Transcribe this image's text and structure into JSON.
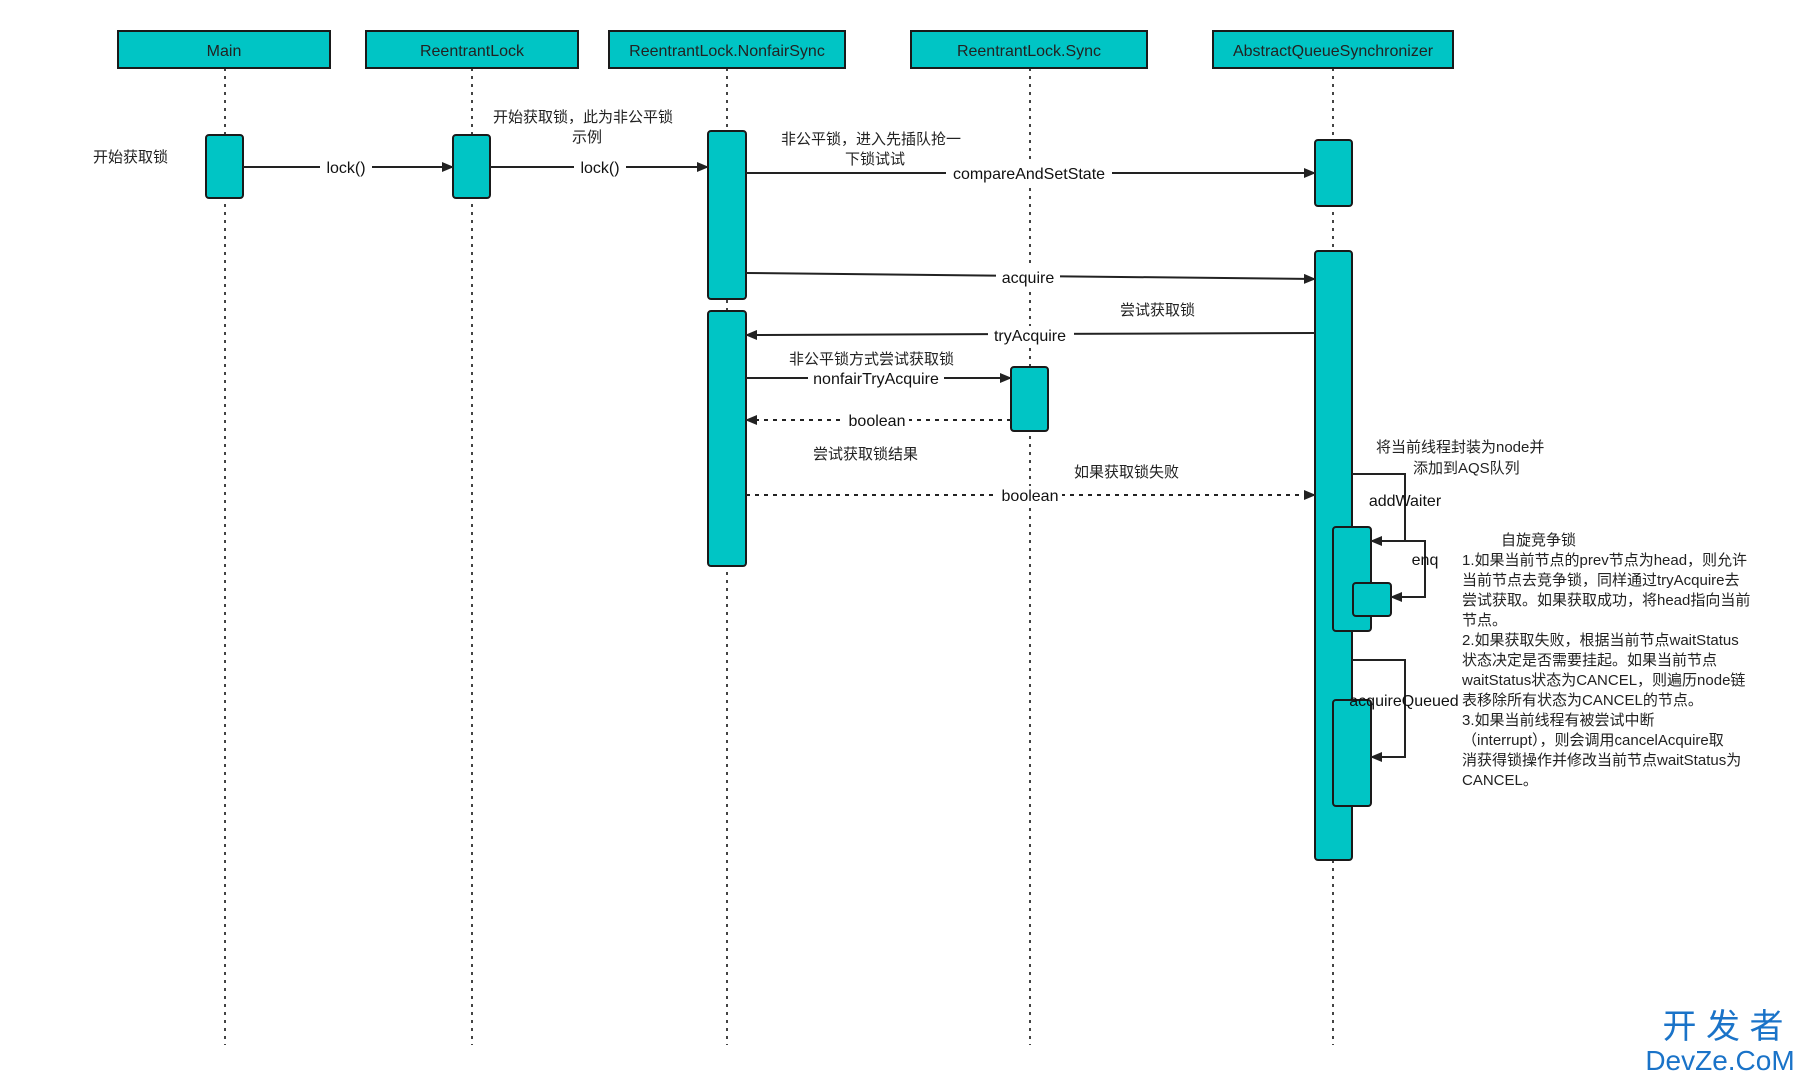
{
  "participants": [
    "Main",
    "ReentrantLock",
    "ReentrantLock.NonfairSync",
    "ReentrantLock.Sync",
    "AbstractQueueSynchronizer"
  ],
  "messages": {
    "main_lock": "lock()",
    "rl_lock": "lock()",
    "cas": "compareAndSetState",
    "acquire": "acquire",
    "try_acquire": "tryAcquire",
    "nonfair_try": "nonfairTryAcquire",
    "ret_boolean": "boolean",
    "ret_boolean2": "boolean",
    "add_waiter": "addWaiter",
    "enq": "enq",
    "acquire_queued": "acquireQueued"
  },
  "notes": {
    "start": "开始获取锁",
    "rl_note_1": "开始获取锁，此为非公平锁",
    "rl_note_2": "示例",
    "nf_note_1": "非公平锁，进入先插队抢一",
    "nf_note_2": "下锁试试",
    "try_note": "尝试获取锁",
    "nonfair_note": "非公平锁方式尝试获取锁",
    "result_note": "尝试获取锁结果",
    "fail_note": "如果获取锁失败",
    "wrap_1": "将当前线程封装为node并",
    "wrap_2": "添加到AQS队列",
    "spin_title": "自旋竞争锁",
    "desc": [
      "1.如果当前节点的prev节点为head，则允许",
      "当前节点去竞争锁，同样通过tryAcquire去",
      "尝试获取。如果获取成功，将head指向当前",
      "节点。",
      "2.如果获取失败，根据当前节点waitStatus",
      "状态决定是否需要挂起。如果当前节点",
      "waitStatus状态为CANCEL，则遍历node链",
      "表移除所有状态为CANCEL的节点。",
      "3.如果当前线程有被尝试中断",
      "（interrupt），则会调用cancelAcquire取",
      "消获得锁操作并修改当前节点waitStatus为",
      "CANCEL。"
    ]
  },
  "watermark": {
    "top": "开 发 者",
    "bottom": "DevZe.CoM"
  },
  "colors": {
    "fill": "#00c5c5",
    "stroke": "#1a1a1a",
    "watermark": "#1a73c8"
  }
}
